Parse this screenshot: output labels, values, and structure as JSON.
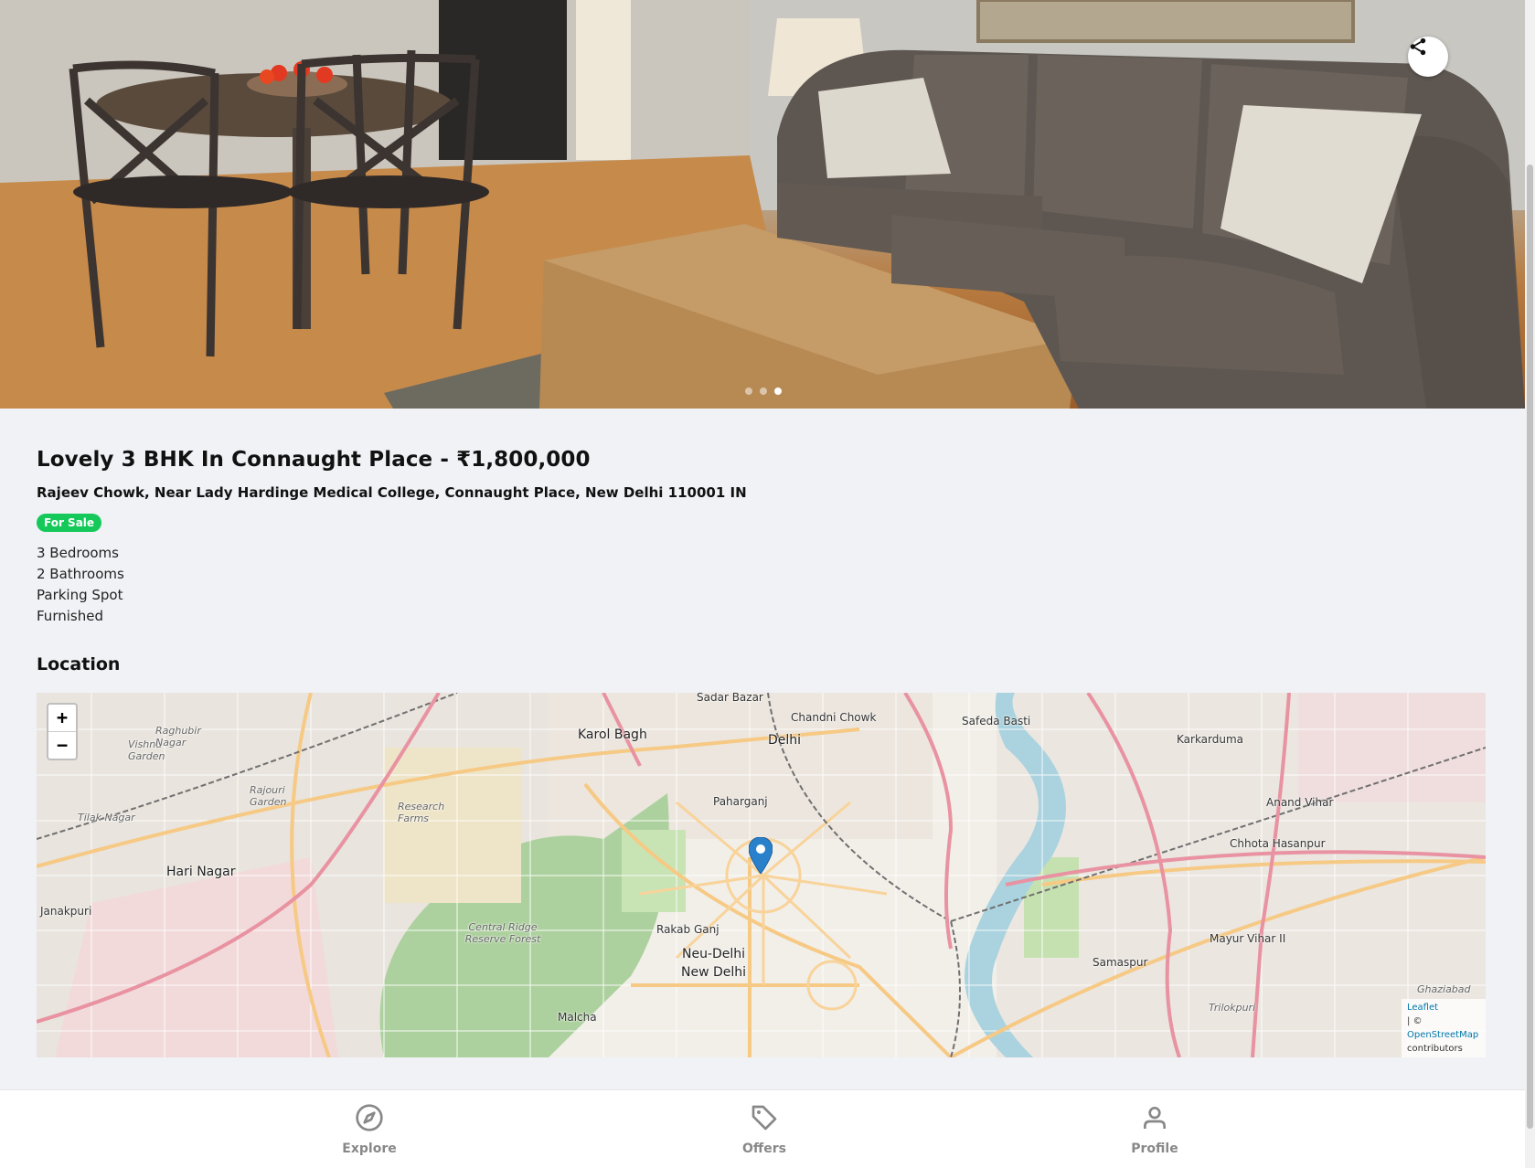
{
  "listing": {
    "title": "Lovely 3 BHK In Connaught Place - ₹1,800,000",
    "address": "Rajeev Chowk, Near Lady Hardinge Medical College, Connaught Place, New Delhi 110001 IN",
    "status_badge": "For Sale",
    "features": [
      "3 Bedrooms",
      "2 Bathrooms",
      "Parking Spot",
      "Furnished"
    ]
  },
  "location": {
    "section_title": "Location",
    "zoom_in": "+",
    "zoom_out": "−",
    "attribution": {
      "leaflet": "Leaflet",
      "separator": "| ©",
      "osm": "OpenStreetMap",
      "suffix": "contributors"
    },
    "labels": [
      "Sadar Bazar",
      "Karol Bagh",
      "Chandni Chowk",
      "Delhi",
      "Safeda Basti",
      "Karkarduma",
      "Paharganj",
      "Anand Vihar",
      "Chhota Hasanpur",
      "Hari Nagar",
      "Janakpuri",
      "Rakab Ganj",
      "Neu-Delhi",
      "New Delhi",
      "Mayur Vihar II",
      "Samaspur",
      "Malcha",
      "Central Ridge Reserve Forest",
      "Research Farms",
      "Tilak Nagar",
      "Vishnu Garden",
      "Raghubir Nagar",
      "Rajouri Garden",
      "Trilokpuri",
      "Ghaziabad"
    ]
  },
  "gallery": {
    "slide_count": 3,
    "active_slide": 3
  },
  "nav": {
    "explore": "Explore",
    "offers": "Offers",
    "profile": "Profile"
  },
  "colors": {
    "badge": "#14c95a",
    "marker": "#2a81cb",
    "nav": "#888888"
  },
  "icons": [
    "share-icon",
    "compass-icon",
    "tag-icon",
    "user-icon",
    "map-marker-icon"
  ]
}
